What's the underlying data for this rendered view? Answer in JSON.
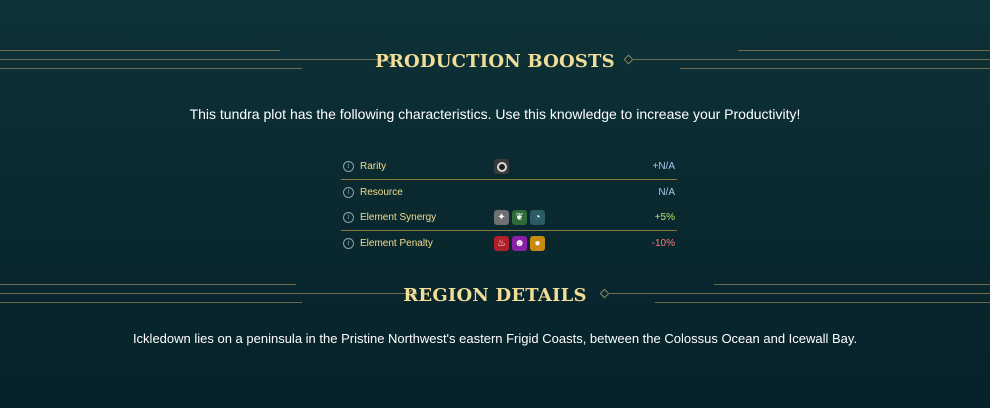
{
  "production": {
    "title": "PRODUCTION BOOSTS",
    "intro": "This tundra plot has the following characteristics. Use this knowledge to increase your Productivity!",
    "rows": [
      {
        "label": "Rarity",
        "icons": [
          "rarity-ring-icon"
        ],
        "value": "+N/A",
        "value_color": "#a9c6f0"
      },
      {
        "label": "Resource",
        "icons": [],
        "value": "N/A",
        "value_color": "#a9c6f0"
      },
      {
        "label": "Element Synergy",
        "icons": [
          "sparkle-element-icon",
          "leaf-element-icon",
          "wave-element-icon"
        ],
        "value": "+5%",
        "value_color": "#b6e26b"
      },
      {
        "label": "Element Penalty",
        "icons": [
          "fire-element-icon",
          "skull-element-icon",
          "egg-element-icon"
        ],
        "value": "-10%",
        "value_color": "#ff7a7a"
      }
    ]
  },
  "region": {
    "title": "REGION DETAILS",
    "description": "Ickledown lies on a peninsula in the Pristine Northwest's eastern Frigid Coasts, between the Colossus Ocean and Icewall Bay."
  },
  "colors": {
    "accent_gold": "#f1dd95",
    "line_gold": "#6e6a4c",
    "synergy_green": "#b6e26b",
    "penalty_red": "#ff7a7a"
  }
}
